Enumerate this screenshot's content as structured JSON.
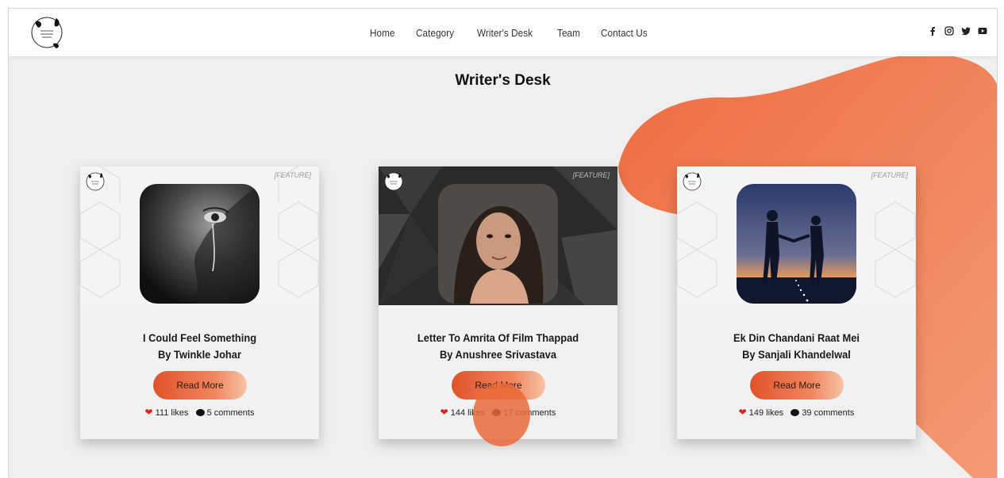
{
  "nav": {
    "links": [
      "Home",
      "Category",
      "Writer's Desk",
      "Team",
      "Contact Us"
    ],
    "social": [
      "facebook-icon",
      "instagram-icon",
      "twitter-icon",
      "youtube-icon"
    ]
  },
  "page": {
    "title": "Writer's Desk"
  },
  "colors": {
    "accent": "#e8572d",
    "background": "#efefef"
  },
  "cards": [
    {
      "tag": "[FEATURE]",
      "title_line1": "I Could Feel Something",
      "title_line2": "By Twinkle Johar",
      "button": "Read More",
      "likes": "111 likes",
      "comments": "5 comments"
    },
    {
      "tag": "[FEATURE]",
      "title_line1": "Letter To Amrita Of Film Thappad",
      "title_line2": "By Anushree Srivastava",
      "button": "Read More",
      "likes": "144 likes",
      "comments": "17 comments"
    },
    {
      "tag": "[FEATURE]",
      "title_line1": "Ek Din Chandani Raat Mei",
      "title_line2": "By Sanjali Khandelwal",
      "button": "Read More",
      "likes": "149 likes",
      "comments": "39 comments"
    }
  ]
}
